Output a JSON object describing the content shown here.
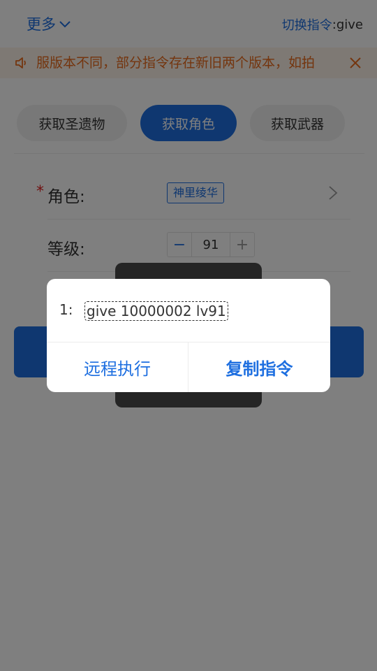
{
  "header": {
    "more_label": "更多",
    "switch_label": "切换指令",
    "switch_value": ":give"
  },
  "notice": {
    "text": "服版本不同，部分指令存在新旧两个版本，如拍"
  },
  "tabs": [
    {
      "label": "获取圣遗物",
      "active": false
    },
    {
      "label": "获取角色",
      "active": true
    },
    {
      "label": "获取武器",
      "active": false
    }
  ],
  "form": {
    "role_required_mark": "*",
    "role_label": "角色:",
    "role_value": "神里绫华",
    "level_label": "等级:",
    "level_value": "91",
    "minus": "−",
    "plus": "+"
  },
  "dialog": {
    "index": "1:",
    "command": "give 10000002 lv91",
    "remote_label": "远程执行",
    "copy_label": "复制指令"
  },
  "colors": {
    "accent": "#1e6fe0",
    "notice_text": "#e86a1c",
    "notice_bg": "#fdf3e8",
    "required": "#e02020"
  },
  "icons": {
    "more": "chevron-down-icon",
    "notice": "speaker-icon",
    "notice_close": "close-icon",
    "role_arrow": "chevron-right-icon"
  }
}
